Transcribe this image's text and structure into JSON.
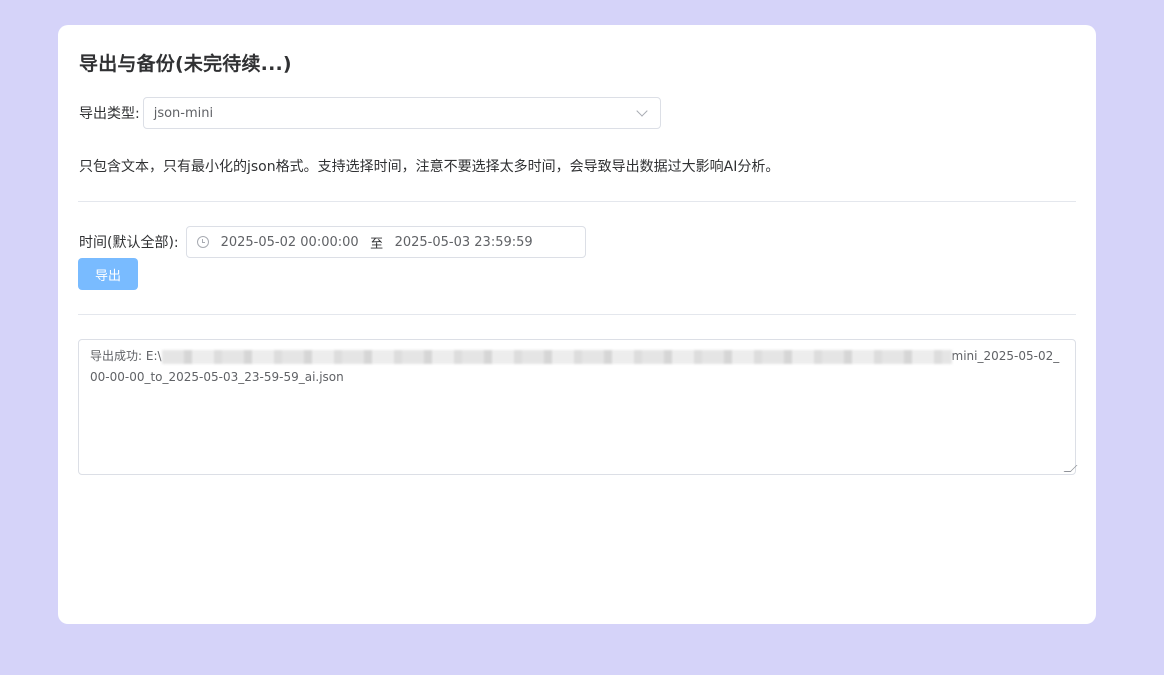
{
  "header": {
    "title": "导出与备份(未完待续...)"
  },
  "export_type": {
    "label": "导出类型:",
    "selected": "json-mini",
    "icon": "chevron-down-icon"
  },
  "description": "只包含文本，只有最小化的json格式。支持选择时间，注意不要选择太多时间，会导致导出数据过大影响AI分析。",
  "time_range": {
    "label": "时间(默认全部):",
    "icon": "clock-icon",
    "start": "2025-05-02 00:00:00",
    "separator": "至",
    "end": "2025-05-03 23:59:59"
  },
  "actions": {
    "export_label": "导出"
  },
  "result": {
    "prefix": "导出成功: E:\\",
    "suffix": "mini_2025-05-02_00-00-00_to_2025-05-03_23-59-59_ai.json"
  },
  "colors": {
    "background": "#d5d3f9",
    "card": "#ffffff",
    "primary_disabled": "#79bbff",
    "border": "#dcdfe6"
  }
}
